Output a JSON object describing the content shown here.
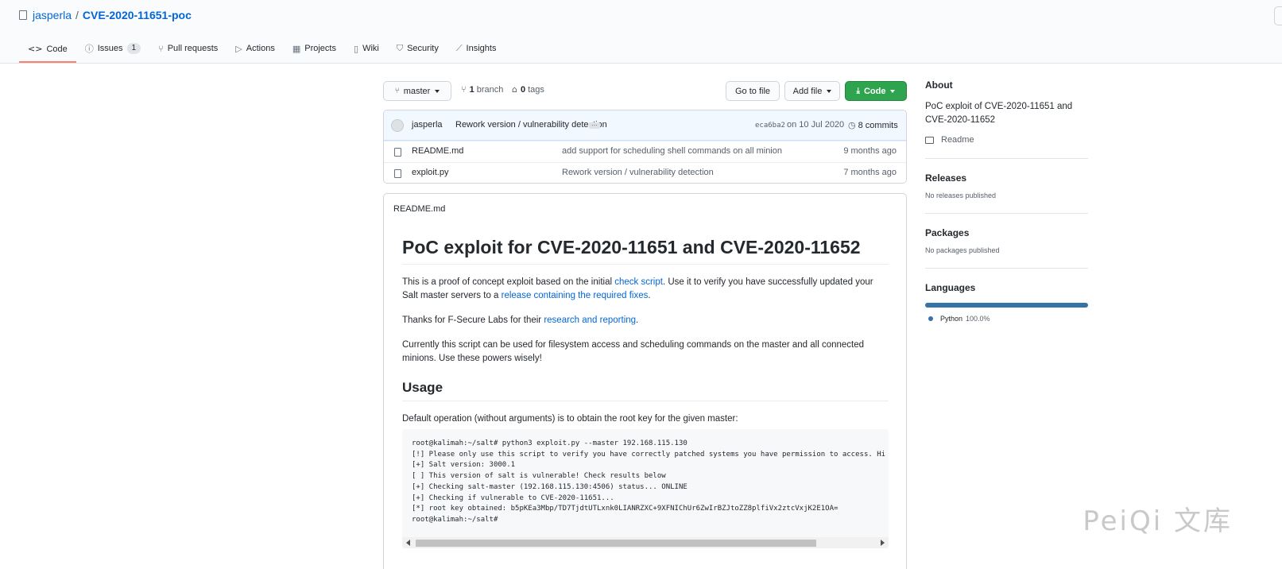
{
  "repo": {
    "owner": "jasperla",
    "separator": "/",
    "name": "CVE-2020-11651-poc"
  },
  "tabs": [
    {
      "label": "Code",
      "icon": "code-icon",
      "glyph": "<>"
    },
    {
      "label": "Issues",
      "icon": "issue-icon",
      "glyph": "ⓘ",
      "count": "1"
    },
    {
      "label": "Pull requests",
      "icon": "pull-request-icon",
      "glyph": "⑂"
    },
    {
      "label": "Actions",
      "icon": "play-icon",
      "glyph": "▷"
    },
    {
      "label": "Projects",
      "icon": "project-icon",
      "glyph": "▦"
    },
    {
      "label": "Wiki",
      "icon": "book-icon",
      "glyph": "▯"
    },
    {
      "label": "Security",
      "icon": "shield-icon",
      "glyph": "⛉"
    },
    {
      "label": "Insights",
      "icon": "graph-icon",
      "glyph": "⟋"
    }
  ],
  "toolbar": {
    "branch_label": "master",
    "branches_count": "1",
    "branches_label": "branch",
    "tags_count": "0",
    "tags_label": "tags",
    "go_to_file": "Go to file",
    "add_file": "Add file",
    "code": "Code"
  },
  "commit": {
    "author": "jasperla",
    "message": "Rework version / vulnerability detection",
    "ellipsis": "…",
    "sha": "eca6ba2",
    "date": "on 10 Jul 2020",
    "count": "8 commits"
  },
  "files": [
    {
      "name": "README.md",
      "commit": "add support for scheduling shell commands on all minion",
      "age": "9 months ago"
    },
    {
      "name": "exploit.py",
      "commit": "Rework version / vulnerability detection",
      "age": "7 months ago"
    }
  ],
  "readme": {
    "filename": "README.md",
    "title": "PoC exploit for CVE-2020-11651 and CVE-2020-11652",
    "p1_a": "This is a proof of concept exploit based on the initial ",
    "p1_link1": "check script",
    "p1_b": ". Use it to verify you have successfully updated your Salt master servers to a ",
    "p1_link2": "release containing the required fixes",
    "p1_c": ".",
    "p2_a": "Thanks for F-Secure Labs for their ",
    "p2_link": "research and reporting",
    "p2_b": ".",
    "p3": "Currently this script can be used for filesystem access and scheduling commands on the master and all connected minions. Use these powers wisely!",
    "usage_heading": "Usage",
    "p4": "Default operation (without arguments) is to obtain the root key for the given master:",
    "code_lines": [
      "root@kalimah:~/salt# python3 exploit.py --master 192.168.115.130",
      "[!] Please only use this script to verify you have correctly patched systems you have permission to access. Hi",
      "[+] Salt version: 3000.1",
      "[ ] This version of salt is vulnerable! Check results below",
      "[+] Checking salt-master (192.168.115.130:4506) status... ONLINE",
      "[+] Checking if vulnerable to CVE-2020-11651...",
      "[*] root key obtained: b5pKEa3Mbp/TD7TjdtUTLxnk0LIANRZXC+9XFNIChUr6ZwIrBZJtoZZ8plfiVx2ztcVxjK2E1OA=",
      "root@kalimah:~/salt#"
    ]
  },
  "sidebar": {
    "about_heading": "About",
    "description": "PoC exploit of CVE-2020-11651 and CVE-2020-11652",
    "readme_link": "Readme",
    "releases_heading": "Releases",
    "releases_text": "No releases published",
    "packages_heading": "Packages",
    "packages_text": "No packages published",
    "languages_heading": "Languages",
    "language_name": "Python",
    "language_pct": "100.0%",
    "language_color": "#3572a5"
  },
  "watermark": "PeiQi 文库",
  "colors": {
    "accent": "#0366d6",
    "green": "#2ea44f",
    "tab_underline": "#f9826c"
  }
}
